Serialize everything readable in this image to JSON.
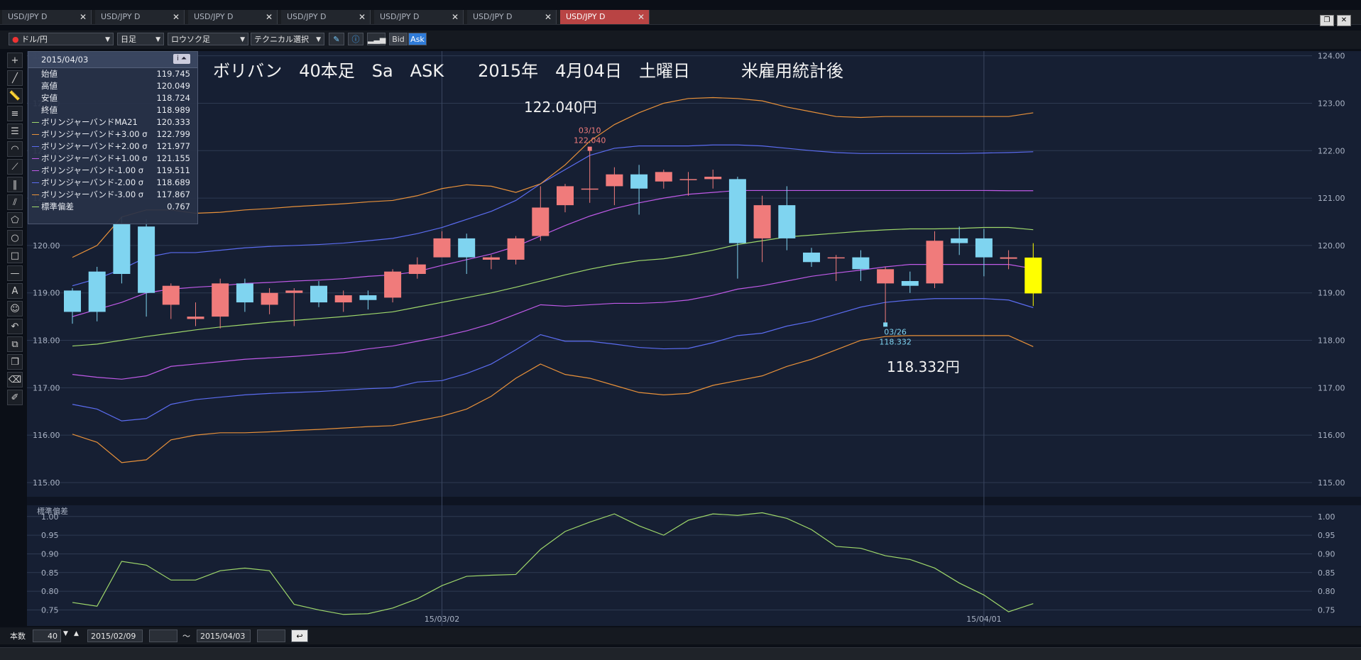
{
  "tabs": [
    {
      "label": "USD/JPY D",
      "active": false
    },
    {
      "label": "USD/JPY D",
      "active": false
    },
    {
      "label": "USD/JPY D",
      "active": false
    },
    {
      "label": "USD/JPY D",
      "active": false
    },
    {
      "label": "USD/JPY D",
      "active": false
    },
    {
      "label": "USD/JPY D",
      "active": false
    },
    {
      "label": "USD/JPY D",
      "active": true
    }
  ],
  "toolbar": {
    "pair": "ドル/円",
    "period": "日足",
    "chart_type": "ロウソク足",
    "indicator": "テクニカル選択",
    "bid": "Bid",
    "ask": "Ask"
  },
  "tools": [
    "crosshair-icon",
    "line-icon",
    "ruler-icon",
    "horizontal-lines-icon",
    "fib-icon",
    "arc-icon",
    "fan-icon",
    "vertical-lines-icon",
    "channel-icon",
    "pentagon-icon",
    "circle-icon",
    "rectangle-icon",
    "hline-icon",
    "text-icon",
    "emoji-icon",
    "undo-icon",
    "copy-icon",
    "pages-icon",
    "eraser-icon",
    "eraser-all-icon"
  ],
  "tool_labels": {
    "text": "A"
  },
  "info_panel": {
    "date": "2015/04/03",
    "rows": [
      {
        "label": "始値",
        "value": "119.745",
        "color": ""
      },
      {
        "label": "高値",
        "value": "120.049",
        "color": ""
      },
      {
        "label": "安値",
        "value": "118.724",
        "color": ""
      },
      {
        "label": "終値",
        "value": "118.989",
        "color": ""
      },
      {
        "label": "ボリンジャーバンドMA21",
        "value": "120.333",
        "color": "#9fd86b"
      },
      {
        "label": "ボリンジャーバンド+3.00 σ",
        "value": "122.799",
        "color": "#e8913a"
      },
      {
        "label": "ボリンジャーバンド+2.00 σ",
        "value": "121.977",
        "color": "#5b6cf0"
      },
      {
        "label": "ボリンジャーバンド+1.00 σ",
        "value": "121.155",
        "color": "#c05ae8"
      },
      {
        "label": "ボリンジャーバンド-1.00 σ",
        "value": "119.511",
        "color": "#c05ae8"
      },
      {
        "label": "ボリンジャーバンド-2.00 σ",
        "value": "118.689",
        "color": "#5b6cf0"
      },
      {
        "label": "ボリンジャーバンド-3.00 σ",
        "value": "117.867",
        "color": "#e8913a"
      },
      {
        "label": "標準偏差",
        "value": "0.767",
        "color": "#9fd86b"
      }
    ]
  },
  "annotations": {
    "title": "ボリバン　40本足　Sa　ASK　　2015年　4月04日　土曜日　　　米雇用統計後",
    "high_label": "122.040円",
    "low_label": "118.332円",
    "high_marker_date": "03/10",
    "high_marker_value": "122.040",
    "low_marker_date": "03/26",
    "low_marker_value": "118.332"
  },
  "lower_panel_label": "標準偏差",
  "bottom": {
    "count_label": "本数",
    "count_value": "40",
    "from_date": "2015/02/09",
    "tilde": "～",
    "to_date": "2015/04/03"
  },
  "chart_data": {
    "type": "candlestick",
    "y_axis_ticks": [
      "124.00",
      "123.00",
      "122.00",
      "121.00",
      "120.00",
      "119.00",
      "118.00",
      "117.00",
      "116.00",
      "115.00"
    ],
    "ylim": [
      114.7,
      124.1
    ],
    "x_tick_labels": [
      {
        "index": 15,
        "label": "15/03/02"
      },
      {
        "index": 37,
        "label": "15/04/01"
      }
    ],
    "candles": [
      {
        "o": 118.6,
        "h": 119.1,
        "l": 118.35,
        "c": 119.05
      },
      {
        "o": 118.6,
        "h": 119.55,
        "l": 118.4,
        "c": 119.45
      },
      {
        "o": 119.4,
        "h": 120.6,
        "l": 119.2,
        "c": 120.45
      },
      {
        "o": 119.0,
        "h": 120.55,
        "l": 118.5,
        "c": 120.4
      },
      {
        "o": 119.15,
        "h": 119.2,
        "l": 118.45,
        "c": 118.75
      },
      {
        "o": 118.5,
        "h": 118.8,
        "l": 118.3,
        "c": 118.45
      },
      {
        "o": 119.2,
        "h": 119.3,
        "l": 118.25,
        "c": 118.5
      },
      {
        "o": 118.8,
        "h": 119.3,
        "l": 118.6,
        "c": 119.2
      },
      {
        "o": 119.0,
        "h": 119.1,
        "l": 118.55,
        "c": 118.75
      },
      {
        "o": 119.05,
        "h": 119.1,
        "l": 118.3,
        "c": 119.0
      },
      {
        "o": 118.8,
        "h": 119.25,
        "l": 118.7,
        "c": 119.15
      },
      {
        "o": 118.95,
        "h": 119.05,
        "l": 118.6,
        "c": 118.8
      },
      {
        "o": 118.85,
        "h": 119.05,
        "l": 118.65,
        "c": 118.95
      },
      {
        "o": 119.45,
        "h": 119.5,
        "l": 118.8,
        "c": 118.9
      },
      {
        "o": 119.6,
        "h": 119.75,
        "l": 119.3,
        "c": 119.4
      },
      {
        "o": 120.15,
        "h": 120.3,
        "l": 119.8,
        "c": 119.75
      },
      {
        "o": 119.75,
        "h": 120.25,
        "l": 119.4,
        "c": 120.15
      },
      {
        "o": 119.75,
        "h": 119.8,
        "l": 119.5,
        "c": 119.7
      },
      {
        "o": 120.15,
        "h": 120.2,
        "l": 119.6,
        "c": 119.7
      },
      {
        "o": 120.8,
        "h": 121.25,
        "l": 120.1,
        "c": 120.2
      },
      {
        "o": 121.25,
        "h": 121.3,
        "l": 120.7,
        "c": 120.85
      },
      {
        "o": 121.2,
        "h": 122.04,
        "l": 120.9,
        "c": 121.2
      },
      {
        "o": 121.5,
        "h": 121.65,
        "l": 120.85,
        "c": 121.25
      },
      {
        "o": 121.2,
        "h": 121.7,
        "l": 120.65,
        "c": 121.5
      },
      {
        "o": 121.55,
        "h": 121.6,
        "l": 121.2,
        "c": 121.35
      },
      {
        "o": 121.4,
        "h": 121.55,
        "l": 121.05,
        "c": 121.4
      },
      {
        "o": 121.45,
        "h": 121.6,
        "l": 121.2,
        "c": 121.4
      },
      {
        "o": 120.05,
        "h": 121.45,
        "l": 119.3,
        "c": 121.4
      },
      {
        "o": 120.85,
        "h": 121.05,
        "l": 119.65,
        "c": 120.15
      },
      {
        "o": 120.15,
        "h": 121.25,
        "l": 119.9,
        "c": 120.85
      },
      {
        "o": 119.65,
        "h": 119.95,
        "l": 119.55,
        "c": 119.85
      },
      {
        "o": 119.75,
        "h": 119.8,
        "l": 119.25,
        "c": 119.75
      },
      {
        "o": 119.5,
        "h": 119.9,
        "l": 119.25,
        "c": 119.75
      },
      {
        "o": 119.5,
        "h": 119.55,
        "l": 118.33,
        "c": 119.2
      },
      {
        "o": 119.15,
        "h": 119.45,
        "l": 119.0,
        "c": 119.25
      },
      {
        "o": 120.1,
        "h": 120.3,
        "l": 119.1,
        "c": 119.2
      },
      {
        "o": 120.05,
        "h": 120.4,
        "l": 119.8,
        "c": 120.15
      },
      {
        "o": 119.75,
        "h": 120.35,
        "l": 119.35,
        "c": 120.15
      },
      {
        "o": 119.75,
        "h": 119.9,
        "l": 119.5,
        "c": 119.72
      },
      {
        "o": 119.745,
        "h": 120.049,
        "l": 118.724,
        "c": 118.989
      }
    ],
    "series": [
      {
        "name": "ボリンジャーバンドMA21",
        "color": "#9fd86b",
        "values": [
          117.88,
          117.92,
          118.0,
          118.08,
          118.15,
          118.22,
          118.28,
          118.33,
          118.38,
          118.42,
          118.46,
          118.5,
          118.55,
          118.6,
          118.7,
          118.8,
          118.9,
          119.0,
          119.12,
          119.25,
          119.38,
          119.5,
          119.6,
          119.68,
          119.72,
          119.8,
          119.9,
          120.02,
          120.1,
          120.18,
          120.22,
          120.26,
          120.3,
          120.33,
          120.35,
          120.35,
          120.36,
          120.38,
          120.38,
          120.333
        ]
      },
      {
        "name": "ボリンジャーバンド+1.00 σ",
        "color": "#c05ae8",
        "values": [
          118.5,
          118.65,
          118.8,
          119.0,
          119.08,
          119.12,
          119.15,
          119.2,
          119.22,
          119.25,
          119.27,
          119.3,
          119.35,
          119.38,
          119.45,
          119.58,
          119.7,
          119.82,
          119.98,
          120.2,
          120.42,
          120.62,
          120.78,
          120.9,
          121.0,
          121.08,
          121.12,
          121.16,
          121.16,
          121.16,
          121.16,
          121.16,
          121.16,
          121.16,
          121.16,
          121.16,
          121.16,
          121.16,
          121.155,
          121.155
        ]
      },
      {
        "name": "ボリンジャーバンド-1.00 σ",
        "color": "#c05ae8",
        "values": [
          117.28,
          117.22,
          117.18,
          117.25,
          117.45,
          117.5,
          117.55,
          117.6,
          117.63,
          117.66,
          117.7,
          117.74,
          117.82,
          117.88,
          117.98,
          118.08,
          118.2,
          118.35,
          118.55,
          118.75,
          118.72,
          118.75,
          118.78,
          118.78,
          118.8,
          118.85,
          118.95,
          119.08,
          119.15,
          119.25,
          119.35,
          119.42,
          119.48,
          119.55,
          119.6,
          119.6,
          119.6,
          119.6,
          119.6,
          119.511
        ]
      },
      {
        "name": "ボリンジャーバンド+2.00 σ",
        "color": "#5b6cf0",
        "values": [
          119.15,
          119.3,
          119.5,
          119.75,
          119.85,
          119.85,
          119.9,
          119.95,
          119.98,
          120.0,
          120.02,
          120.05,
          120.1,
          120.15,
          120.25,
          120.38,
          120.55,
          120.72,
          120.95,
          121.3,
          121.6,
          121.9,
          122.05,
          122.1,
          122.1,
          122.1,
          122.12,
          122.12,
          122.1,
          122.05,
          122.0,
          121.96,
          121.94,
          121.94,
          121.94,
          121.94,
          121.94,
          121.95,
          121.96,
          121.977
        ]
      },
      {
        "name": "ボリンジャーバンド-2.00 σ",
        "color": "#5b6cf0",
        "values": [
          116.65,
          116.55,
          116.3,
          116.35,
          116.65,
          116.75,
          116.8,
          116.85,
          116.88,
          116.9,
          116.92,
          116.95,
          116.98,
          117.0,
          117.12,
          117.15,
          117.3,
          117.5,
          117.8,
          118.12,
          117.98,
          117.98,
          117.92,
          117.85,
          117.82,
          117.83,
          117.95,
          118.1,
          118.15,
          118.3,
          118.4,
          118.55,
          118.7,
          118.8,
          118.85,
          118.88,
          118.88,
          118.88,
          118.85,
          118.689
        ]
      },
      {
        "name": "ボリンジャーバンド+3.00 σ",
        "color": "#e8913a",
        "values": [
          119.75,
          120.0,
          120.6,
          120.75,
          120.75,
          120.68,
          120.7,
          120.75,
          120.78,
          120.82,
          120.85,
          120.88,
          120.92,
          120.95,
          121.05,
          121.2,
          121.28,
          121.25,
          121.12,
          121.3,
          121.7,
          122.2,
          122.55,
          122.8,
          123.0,
          123.1,
          123.12,
          123.1,
          123.05,
          122.92,
          122.82,
          122.72,
          122.7,
          122.72,
          122.72,
          122.72,
          122.72,
          122.72,
          122.72,
          122.799
        ]
      },
      {
        "name": "ボリンジャーバンド-3.00 σ",
        "color": "#e8913a",
        "values": [
          116.02,
          115.85,
          115.42,
          115.48,
          115.9,
          116.0,
          116.05,
          116.05,
          116.07,
          116.1,
          116.12,
          116.15,
          116.18,
          116.2,
          116.3,
          116.4,
          116.55,
          116.82,
          117.2,
          117.5,
          117.28,
          117.2,
          117.05,
          116.9,
          116.85,
          116.88,
          117.05,
          117.15,
          117.25,
          117.45,
          117.6,
          117.8,
          118.0,
          118.08,
          118.1,
          118.1,
          118.1,
          118.1,
          118.1,
          117.867
        ]
      }
    ],
    "stddev": {
      "name": "標準偏差",
      "color": "#9fd86b",
      "ylim": [
        0.73,
        1.03
      ],
      "ticks": [
        "1.00",
        "0.95",
        "0.90",
        "0.85",
        "0.80",
        "0.75"
      ],
      "values": [
        0.77,
        0.76,
        0.88,
        0.87,
        0.83,
        0.83,
        0.855,
        0.862,
        0.855,
        0.765,
        0.75,
        0.738,
        0.74,
        0.755,
        0.78,
        0.815,
        0.84,
        0.843,
        0.845,
        0.912,
        0.96,
        0.985,
        1.007,
        0.975,
        0.95,
        0.99,
        1.007,
        1.003,
        1.01,
        0.995,
        0.965,
        0.92,
        0.915,
        0.895,
        0.885,
        0.862,
        0.822,
        0.79,
        0.745,
        0.767
      ]
    }
  }
}
